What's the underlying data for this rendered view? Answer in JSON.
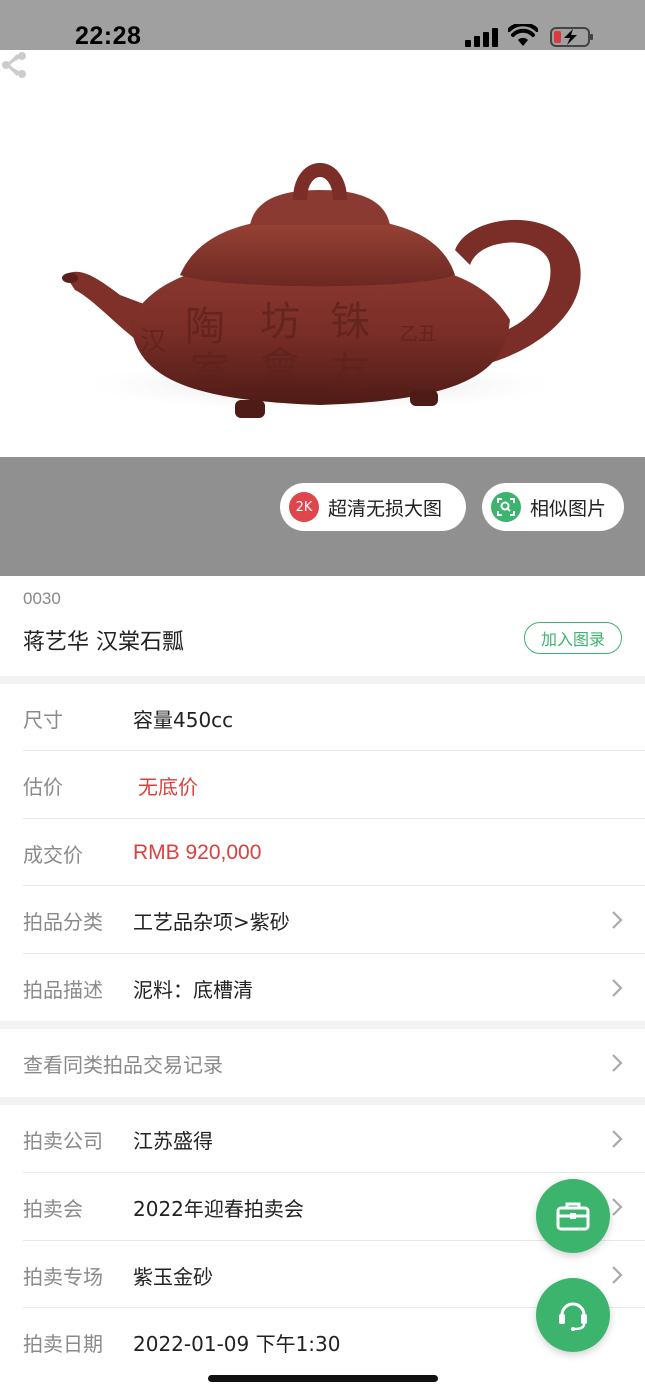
{
  "status_bar": {
    "time": "22:28"
  },
  "hero": {
    "image_description_icon": "teapot-photo",
    "hd_button_badge": "2K",
    "hd_button_label": "超清无损大图",
    "similar_button_label": "相似图片"
  },
  "lot": {
    "number": "0030",
    "title": "蒋艺华 汉棠石瓢",
    "add_catalog_label": "加入图录"
  },
  "details": [
    {
      "label": "尺寸",
      "value": "容量450cc"
    },
    {
      "label": "估价",
      "value": "无底价"
    },
    {
      "label": "成交价",
      "value": "RMB 920,000"
    },
    {
      "label": "拍品分类",
      "value": "工艺品杂项>紫砂"
    },
    {
      "label": "拍品描述",
      "value": "泥料：底槽清"
    }
  ],
  "history_link": "查看同类拍品交易记录",
  "auction_info": [
    {
      "label": "拍卖公司",
      "value": "江苏盛得"
    },
    {
      "label": "拍卖会",
      "value": "2022年迎春拍卖会"
    },
    {
      "label": "拍卖专场",
      "value": "紫玉金砂"
    },
    {
      "label": "拍卖日期",
      "value": "2022-01-09 下午1:30"
    }
  ],
  "colors": {
    "accent": "#3cb46e",
    "price": "#d9413f"
  }
}
